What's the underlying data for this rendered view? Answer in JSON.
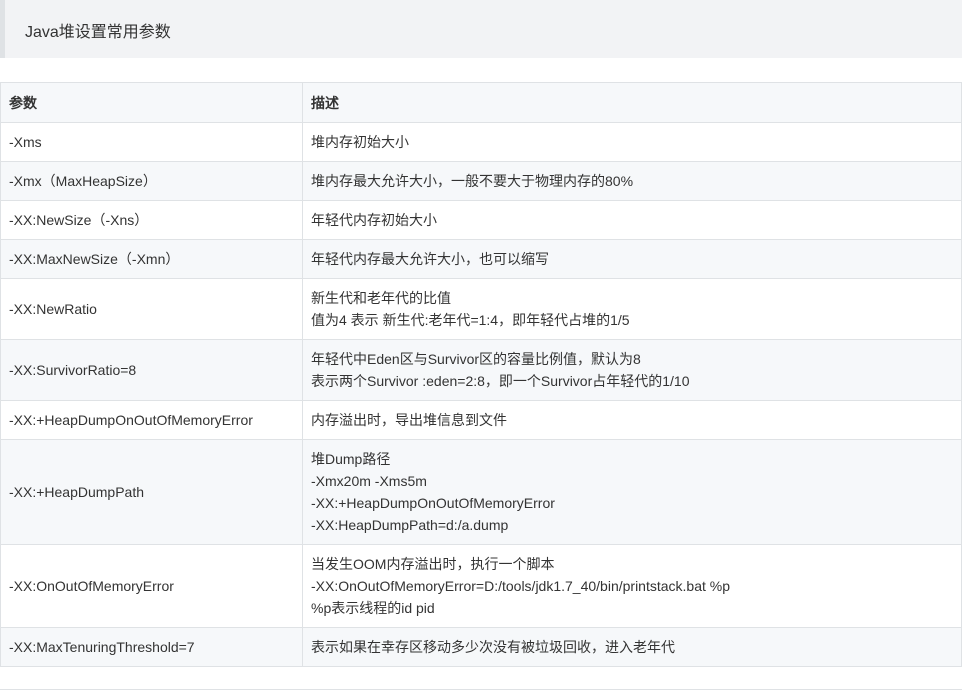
{
  "heading": "Java堆设置常用参数",
  "table": {
    "headers": [
      "参数",
      "描述"
    ],
    "rows": [
      {
        "param": "-Xms",
        "desc": [
          "堆内存初始大小"
        ]
      },
      {
        "param": "-Xmx（MaxHeapSize）",
        "desc": [
          "堆内存最大允许大小，一般不要大于物理内存的80%"
        ]
      },
      {
        "param": "-XX:NewSize（-Xns）",
        "desc": [
          "年轻代内存初始大小"
        ]
      },
      {
        "param": "-XX:MaxNewSize（-Xmn）",
        "desc": [
          "年轻代内存最大允许大小，也可以缩写"
        ]
      },
      {
        "param": "-XX:NewRatio",
        "desc": [
          "新生代和老年代的比值",
          "值为4 表示 新生代:老年代=1:4，即年轻代占堆的1/5"
        ]
      },
      {
        "param": "-XX:SurvivorRatio=8",
        "desc": [
          "年轻代中Eden区与Survivor区的容量比例值，默认为8",
          "表示两个Survivor :eden=2:8，即一个Survivor占年轻代的1/10"
        ]
      },
      {
        "param": "-XX:+HeapDumpOnOutOfMemoryError",
        "desc": [
          "内存溢出时，导出堆信息到文件"
        ]
      },
      {
        "param": "-XX:+HeapDumpPath",
        "desc": [
          "堆Dump路径",
          "-Xmx20m -Xms5m",
          "-XX:+HeapDumpOnOutOfMemoryError",
          "-XX:HeapDumpPath=d:/a.dump"
        ]
      },
      {
        "param": "-XX:OnOutOfMemoryError",
        "desc": [
          "当发生OOM内存溢出时，执行一个脚本",
          "-XX:OnOutOfMemoryError=D:/tools/jdk1.7_40/bin/printstack.bat %p",
          "%p表示线程的id pid"
        ]
      },
      {
        "param": "-XX:MaxTenuringThreshold=7",
        "desc": [
          "表示如果在幸存区移动多少次没有被垃圾回收，进入老年代"
        ]
      }
    ]
  }
}
